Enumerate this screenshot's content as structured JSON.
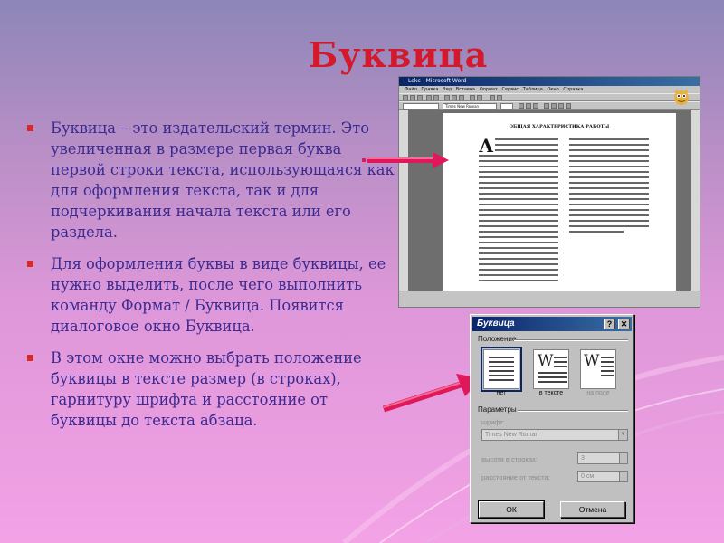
{
  "slide": {
    "title": "Буквица",
    "bullets": [
      "Буквица – это издательский термин. Это увеличенная в размере первая буква первой строки текста, использующаяся как для оформления текста, так и для подчеркивания начала текста или его раздела.",
      "Для оформления буквы в виде буквицы, ее нужно выделить, после чего выполнить команду Формат / Буквица. Появится диалоговое окно Буквица.",
      "В этом окне можно выбрать положение буквицы в тексте размер (в строках), гарнитуру шрифта и расстояние от буквицы до текста абзаца."
    ],
    "colors": {
      "title": "#d21a2c",
      "body_text": "#3b2a90",
      "bullet": "#d52a2a",
      "arrow": "#e0185a"
    }
  },
  "word_window": {
    "title": "Lekc - Microsoft Word",
    "menu": [
      "Файл",
      "Правка",
      "Вид",
      "Вставка",
      "Формат",
      "Сервис",
      "Таблица",
      "Окно",
      "Справка"
    ],
    "font_field": "Times New Roman",
    "page_heading": "ОБЩАЯ ХАРАКТЕРИСТИКА РАБОТЫ",
    "drop_cap_letter": "А",
    "mascot_icon": "office-assistant-icon"
  },
  "dialog": {
    "title": "Буквица",
    "help_button": "?",
    "close_button": "✕",
    "position_section": "Положение",
    "positions": [
      {
        "label": "нет",
        "selected": true
      },
      {
        "label": "в тексте",
        "selected": false,
        "glyph": "W"
      },
      {
        "label": "на поле",
        "selected": false,
        "glyph": "W"
      }
    ],
    "params_section": "Параметры",
    "font_label": "шрифт:",
    "font_value": "Times New Roman",
    "lines_label": "высота в строках:",
    "lines_value": "3",
    "distance_label": "расстояние от текста:",
    "distance_value": "0 см",
    "ok_label": "ОК",
    "cancel_label": "Отмена"
  }
}
